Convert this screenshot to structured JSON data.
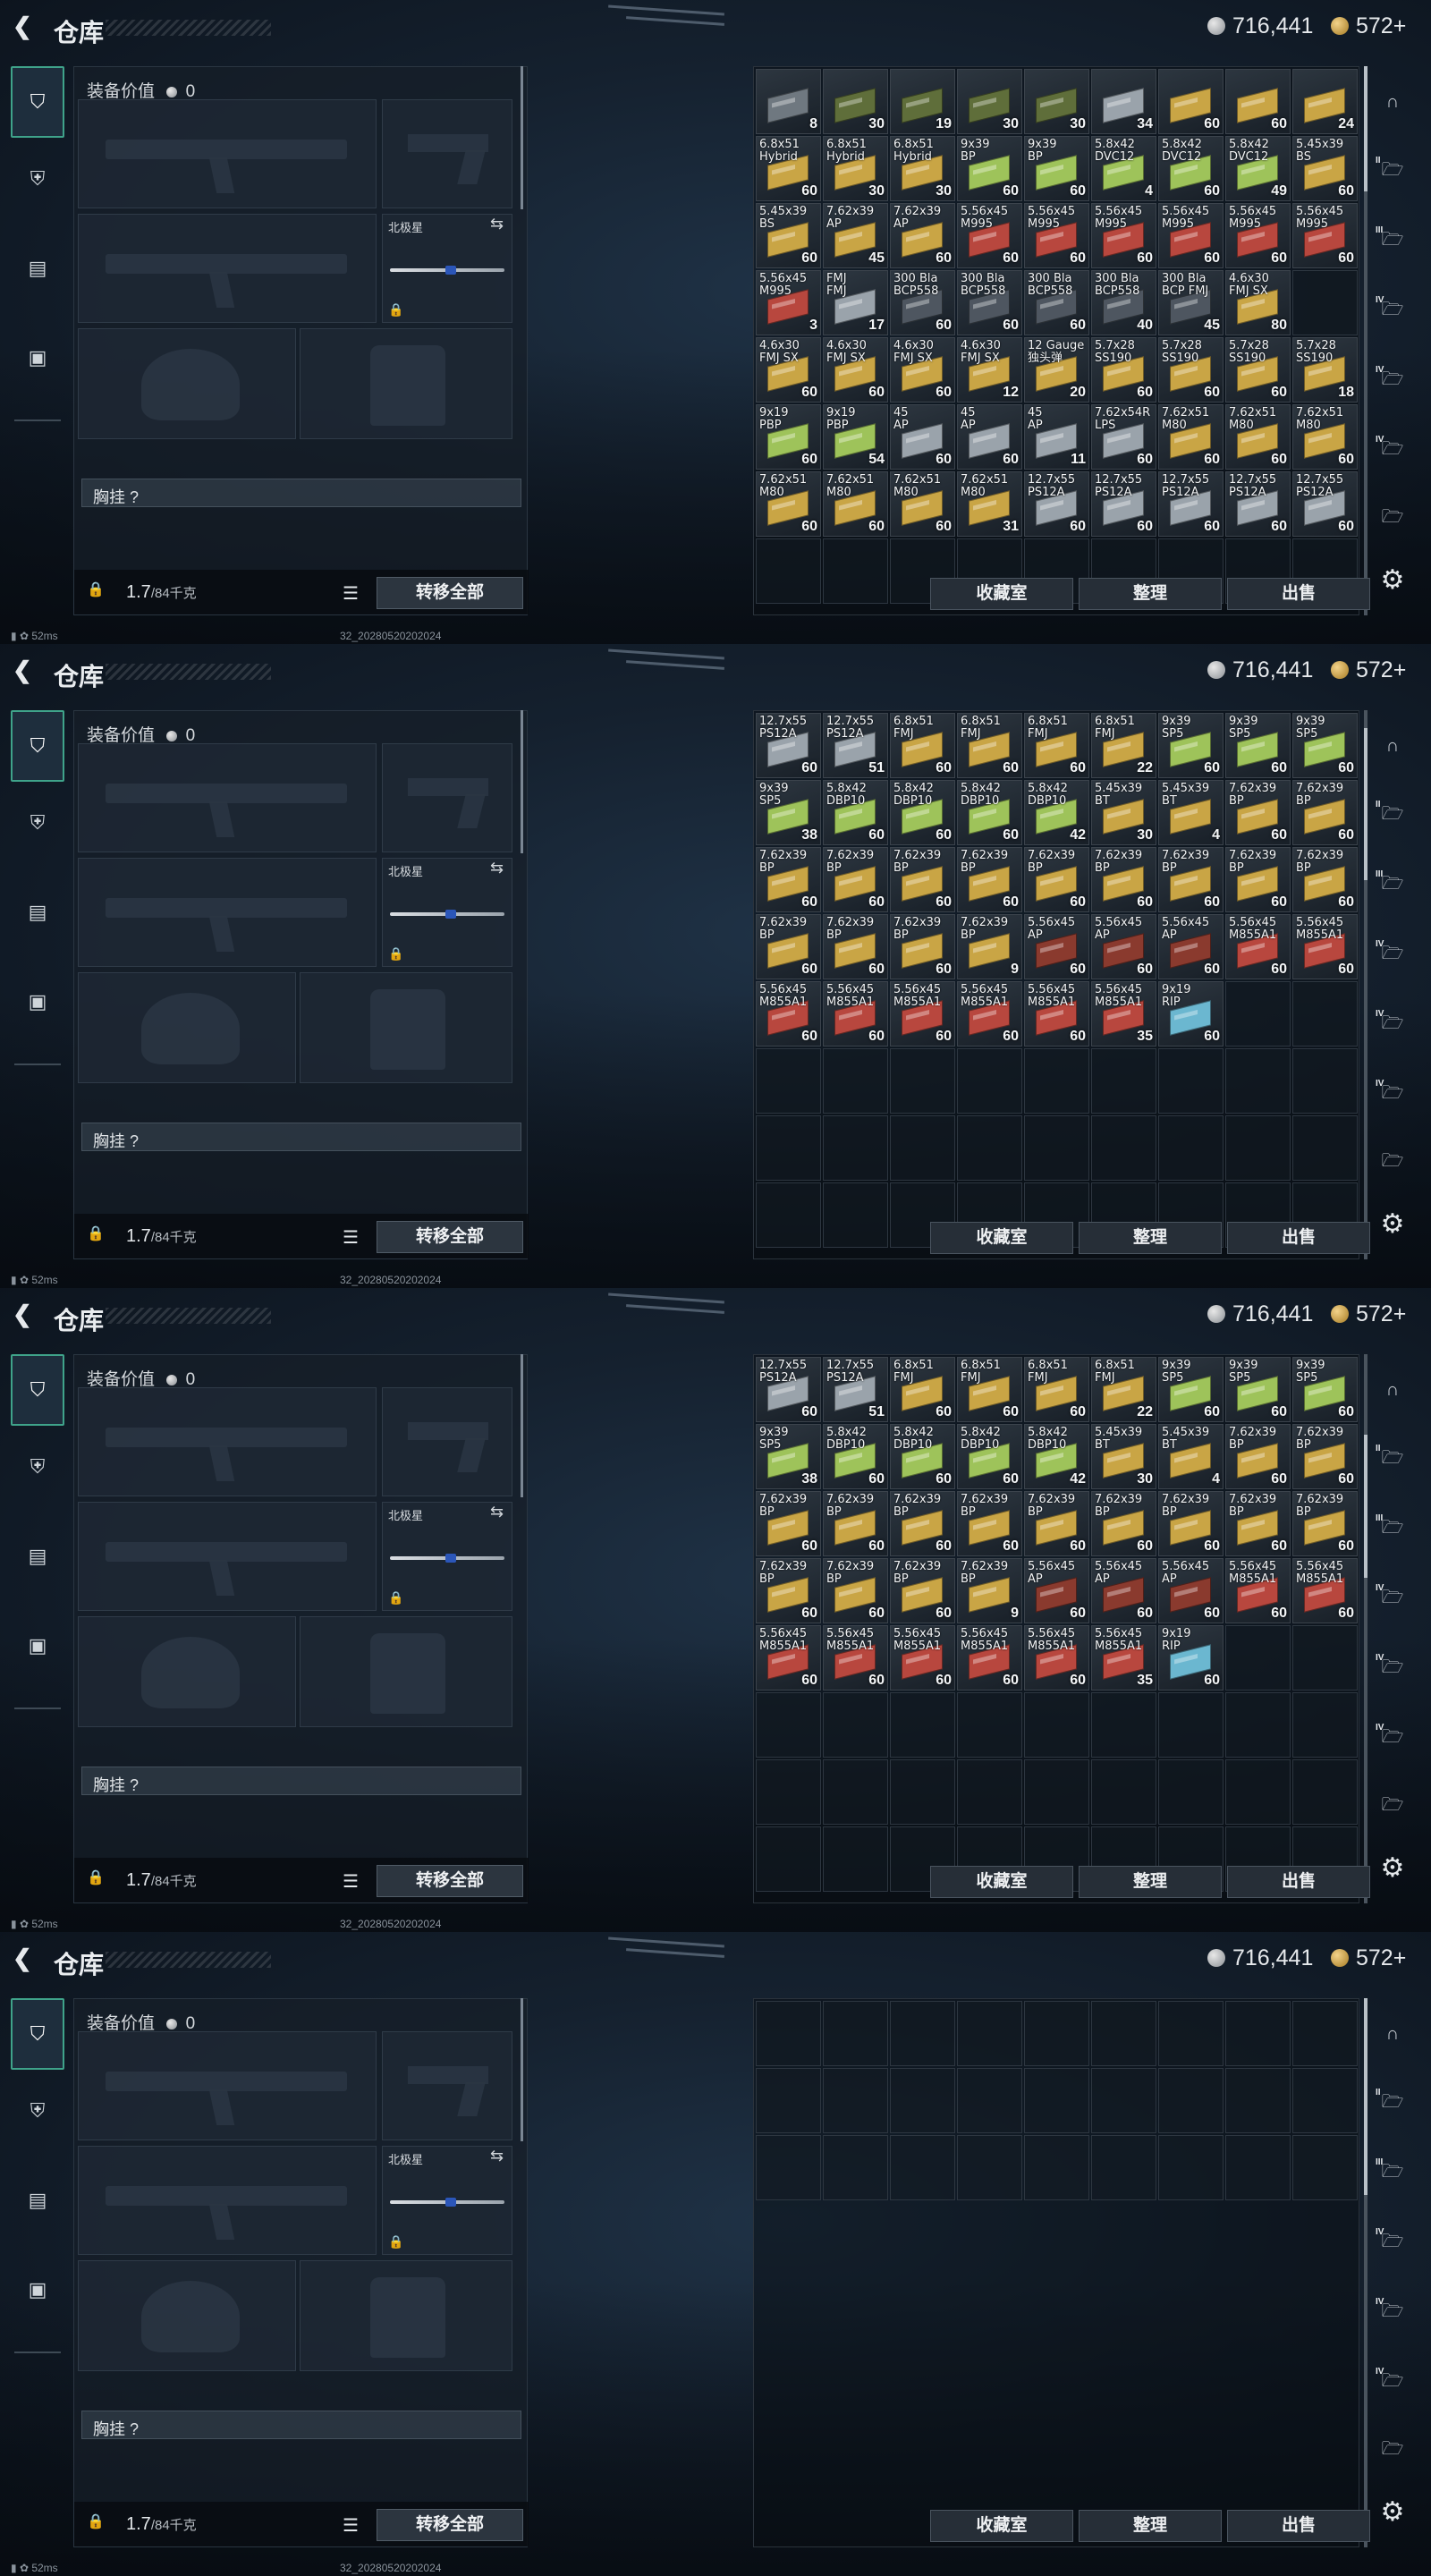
{
  "app": {
    "title": "仓库",
    "back_icon": "back-arrow-icon"
  },
  "currency": {
    "silver": "716,441",
    "gold": "572+"
  },
  "loadout": {
    "header_label": "装备价值",
    "header_value": "0",
    "knife_label": "北极星",
    "chest_rig_label": "胸挂 ?",
    "weight_value": "1.7",
    "weight_capacity": "/84千克",
    "transfer_button": "转移全部"
  },
  "stash_buttons": {
    "collection": "收藏室",
    "sort": "整理",
    "sell": "出售"
  },
  "status": {
    "ping": "52ms",
    "build": "32_20280520202024"
  },
  "colors": {
    "accent": "#3fa38a",
    "gold": "#c9a545",
    "silver": "#b7bcc2"
  },
  "frames": [
    {
      "items": [
        {
          "n": "",
          "q": "8",
          "c": "#6f7880"
        },
        {
          "n": "",
          "q": "30",
          "c": "#5f6e3a"
        },
        {
          "n": "",
          "q": "19",
          "c": "#5f6e3a"
        },
        {
          "n": "",
          "q": "30",
          "c": "#5f6e3a"
        },
        {
          "n": "",
          "q": "30",
          "c": "#5f6e3a"
        },
        {
          "n": "",
          "q": "34",
          "c": "#9aa3ab"
        },
        {
          "n": "",
          "q": "60",
          "c": "#c9a545"
        },
        {
          "n": "",
          "q": "60",
          "c": "#c9a545"
        },
        {
          "n": "",
          "q": "24",
          "c": "#c9a545"
        },
        {
          "n": "6.8x51\nHybrid",
          "q": "60",
          "c": "#c9a545"
        },
        {
          "n": "6.8x51\nHybrid",
          "q": "30",
          "c": "#c9a545"
        },
        {
          "n": "6.8x51\nHybrid",
          "q": "30",
          "c": "#c9a545"
        },
        {
          "n": "9x39\nBP",
          "q": "60",
          "c": "#9ec35a"
        },
        {
          "n": "9x39\nBP",
          "q": "60",
          "c": "#9ec35a"
        },
        {
          "n": "5.8x42\nDVC12",
          "q": "4",
          "c": "#9ec35a"
        },
        {
          "n": "5.8x42\nDVC12",
          "q": "60",
          "c": "#9ec35a"
        },
        {
          "n": "5.8x42\nDVC12",
          "q": "49",
          "c": "#9ec35a"
        },
        {
          "n": "5.45x39\nBS",
          "q": "60",
          "c": "#c9a545"
        },
        {
          "n": "5.45x39\nBS",
          "q": "60",
          "c": "#c9a545"
        },
        {
          "n": "7.62x39\nAP",
          "q": "45",
          "c": "#c9a545"
        },
        {
          "n": "7.62x39\nAP",
          "q": "60",
          "c": "#c9a545"
        },
        {
          "n": "5.56x45\nM995",
          "q": "60",
          "c": "#b8473e"
        },
        {
          "n": "5.56x45\nM995",
          "q": "60",
          "c": "#b8473e"
        },
        {
          "n": "5.56x45\nM995",
          "q": "60",
          "c": "#b8473e"
        },
        {
          "n": "5.56x45\nM995",
          "q": "60",
          "c": "#b8473e"
        },
        {
          "n": "5.56x45\nM995",
          "q": "60",
          "c": "#b8473e"
        },
        {
          "n": "5.56x45\nM995",
          "q": "60",
          "c": "#b8473e"
        },
        {
          "n": "5.56x45\nM995",
          "q": "3",
          "c": "#b8473e"
        },
        {
          "n": "FMJ\nFMJ",
          "q": "17",
          "c": "#9aa3ab"
        },
        {
          "n": "300 Bla\nBCP558",
          "q": "60",
          "c": "#4e5660"
        },
        {
          "n": "300 Bla\nBCP558",
          "q": "60",
          "c": "#4e5660"
        },
        {
          "n": "300 Bla\nBCP558",
          "q": "60",
          "c": "#4e5660"
        },
        {
          "n": "300 Bla\nBCP558",
          "q": "40",
          "c": "#4e5660"
        },
        {
          "n": "300 Bla\nBCP FMJ",
          "q": "45",
          "c": "#4e5660"
        },
        {
          "n": "4.6x30\nFMJ SX",
          "q": "80",
          "c": "#c9a545"
        },
        {
          "n": "",
          "q": "",
          "c": ""
        },
        {
          "n": "4.6x30\nFMJ SX",
          "q": "60",
          "c": "#c9a545"
        },
        {
          "n": "4.6x30\nFMJ SX",
          "q": "60",
          "c": "#c9a545"
        },
        {
          "n": "4.6x30\nFMJ SX",
          "q": "60",
          "c": "#c9a545"
        },
        {
          "n": "4.6x30\nFMJ SX",
          "q": "12",
          "c": "#c9a545"
        },
        {
          "n": "12 Gauge\n独头弹",
          "q": "20",
          "c": "#c9a545"
        },
        {
          "n": "5.7x28\nSS190",
          "q": "60",
          "c": "#c9a545"
        },
        {
          "n": "5.7x28\nSS190",
          "q": "60",
          "c": "#c9a545"
        },
        {
          "n": "5.7x28\nSS190",
          "q": "60",
          "c": "#c9a545"
        },
        {
          "n": "5.7x28\nSS190",
          "q": "18",
          "c": "#c9a545"
        },
        {
          "n": "9x19\nPBP",
          "q": "60",
          "c": "#9ec35a"
        },
        {
          "n": "9x19\nPBP",
          "q": "54",
          "c": "#9ec35a"
        },
        {
          "n": "45\nAP",
          "q": "60",
          "c": "#9aa3ab"
        },
        {
          "n": "45\nAP",
          "q": "60",
          "c": "#9aa3ab"
        },
        {
          "n": "45\nAP",
          "q": "11",
          "c": "#9aa3ab"
        },
        {
          "n": "7.62x54R\nLPS",
          "q": "60",
          "c": "#9aa3ab"
        },
        {
          "n": "7.62x51\nM80",
          "q": "60",
          "c": "#c9a545"
        },
        {
          "n": "7.62x51\nM80",
          "q": "60",
          "c": "#c9a545"
        },
        {
          "n": "7.62x51\nM80",
          "q": "60",
          "c": "#c9a545"
        },
        {
          "n": "7.62x51\nM80",
          "q": "60",
          "c": "#c9a545"
        },
        {
          "n": "7.62x51\nM80",
          "q": "60",
          "c": "#c9a545"
        },
        {
          "n": "7.62x51\nM80",
          "q": "60",
          "c": "#c9a545"
        },
        {
          "n": "7.62x51\nM80",
          "q": "31",
          "c": "#c9a545"
        },
        {
          "n": "12.7x55\nPS12A",
          "q": "60",
          "c": "#9aa3ab"
        },
        {
          "n": "12.7x55\nPS12A",
          "q": "60",
          "c": "#9aa3ab"
        },
        {
          "n": "12.7x55\nPS12A",
          "q": "60",
          "c": "#9aa3ab"
        },
        {
          "n": "12.7x55\nPS12A",
          "q": "60",
          "c": "#9aa3ab"
        },
        {
          "n": "12.7x55\nPS12A",
          "q": "60",
          "c": "#9aa3ab"
        }
      ]
    },
    {
      "items": [
        {
          "n": "12.7x55\nPS12A",
          "q": "60",
          "c": "#9aa3ab"
        },
        {
          "n": "12.7x55\nPS12A",
          "q": "51",
          "c": "#9aa3ab"
        },
        {
          "n": "6.8x51\nFMJ",
          "q": "60",
          "c": "#c9a545"
        },
        {
          "n": "6.8x51\nFMJ",
          "q": "60",
          "c": "#c9a545"
        },
        {
          "n": "6.8x51\nFMJ",
          "q": "60",
          "c": "#c9a545"
        },
        {
          "n": "6.8x51\nFMJ",
          "q": "22",
          "c": "#c9a545"
        },
        {
          "n": "9x39\nSP5",
          "q": "60",
          "c": "#9ec35a"
        },
        {
          "n": "9x39\nSP5",
          "q": "60",
          "c": "#9ec35a"
        },
        {
          "n": "9x39\nSP5",
          "q": "60",
          "c": "#9ec35a"
        },
        {
          "n": "9x39\nSP5",
          "q": "38",
          "c": "#9ec35a"
        },
        {
          "n": "5.8x42\nDBP10",
          "q": "60",
          "c": "#9ec35a"
        },
        {
          "n": "5.8x42\nDBP10",
          "q": "60",
          "c": "#9ec35a"
        },
        {
          "n": "5.8x42\nDBP10",
          "q": "60",
          "c": "#9ec35a"
        },
        {
          "n": "5.8x42\nDBP10",
          "q": "42",
          "c": "#9ec35a"
        },
        {
          "n": "5.45x39\nBT",
          "q": "30",
          "c": "#c9a545"
        },
        {
          "n": "5.45x39\nBT",
          "q": "4",
          "c": "#c9a545"
        },
        {
          "n": "7.62x39\nBP",
          "q": "60",
          "c": "#c9a545"
        },
        {
          "n": "7.62x39\nBP",
          "q": "60",
          "c": "#c9a545"
        },
        {
          "n": "7.62x39\nBP",
          "q": "60",
          "c": "#c9a545"
        },
        {
          "n": "7.62x39\nBP",
          "q": "60",
          "c": "#c9a545"
        },
        {
          "n": "7.62x39\nBP",
          "q": "60",
          "c": "#c9a545"
        },
        {
          "n": "7.62x39\nBP",
          "q": "60",
          "c": "#c9a545"
        },
        {
          "n": "7.62x39\nBP",
          "q": "60",
          "c": "#c9a545"
        },
        {
          "n": "7.62x39\nBP",
          "q": "60",
          "c": "#c9a545"
        },
        {
          "n": "7.62x39\nBP",
          "q": "60",
          "c": "#c9a545"
        },
        {
          "n": "7.62x39\nBP",
          "q": "60",
          "c": "#c9a545"
        },
        {
          "n": "7.62x39\nBP",
          "q": "60",
          "c": "#c9a545"
        },
        {
          "n": "7.62x39\nBP",
          "q": "60",
          "c": "#c9a545"
        },
        {
          "n": "7.62x39\nBP",
          "q": "60",
          "c": "#c9a545"
        },
        {
          "n": "7.62x39\nBP",
          "q": "60",
          "c": "#c9a545"
        },
        {
          "n": "7.62x39\nBP",
          "q": "9",
          "c": "#c9a545"
        },
        {
          "n": "5.56x45\nAP",
          "q": "60",
          "c": "#8a3a2e"
        },
        {
          "n": "5.56x45\nAP",
          "q": "60",
          "c": "#8a3a2e"
        },
        {
          "n": "5.56x45\nAP",
          "q": "60",
          "c": "#8a3a2e"
        },
        {
          "n": "5.56x45\nM855A1",
          "q": "60",
          "c": "#b8473e"
        },
        {
          "n": "5.56x45\nM855A1",
          "q": "60",
          "c": "#b8473e"
        },
        {
          "n": "5.56x45\nM855A1",
          "q": "60",
          "c": "#b8473e"
        },
        {
          "n": "5.56x45\nM855A1",
          "q": "60",
          "c": "#b8473e"
        },
        {
          "n": "5.56x45\nM855A1",
          "q": "60",
          "c": "#b8473e"
        },
        {
          "n": "5.56x45\nM855A1",
          "q": "60",
          "c": "#b8473e"
        },
        {
          "n": "5.56x45\nM855A1",
          "q": "60",
          "c": "#b8473e"
        },
        {
          "n": "5.56x45\nM855A1",
          "q": "35",
          "c": "#b8473e"
        },
        {
          "n": "9x19\nRIP",
          "q": "60",
          "c": "#6bb7d0"
        }
      ]
    },
    {
      "items": [
        {
          "n": "12.7x55\nPS12A",
          "q": "60",
          "c": "#9aa3ab"
        },
        {
          "n": "12.7x55\nPS12A",
          "q": "51",
          "c": "#9aa3ab"
        },
        {
          "n": "6.8x51\nFMJ",
          "q": "60",
          "c": "#c9a545"
        },
        {
          "n": "6.8x51\nFMJ",
          "q": "60",
          "c": "#c9a545"
        },
        {
          "n": "6.8x51\nFMJ",
          "q": "60",
          "c": "#c9a545"
        },
        {
          "n": "6.8x51\nFMJ",
          "q": "22",
          "c": "#c9a545"
        },
        {
          "n": "9x39\nSP5",
          "q": "60",
          "c": "#9ec35a"
        },
        {
          "n": "9x39\nSP5",
          "q": "60",
          "c": "#9ec35a"
        },
        {
          "n": "9x39\nSP5",
          "q": "60",
          "c": "#9ec35a"
        },
        {
          "n": "9x39\nSP5",
          "q": "38",
          "c": "#9ec35a"
        },
        {
          "n": "5.8x42\nDBP10",
          "q": "60",
          "c": "#9ec35a"
        },
        {
          "n": "5.8x42\nDBP10",
          "q": "60",
          "c": "#9ec35a"
        },
        {
          "n": "5.8x42\nDBP10",
          "q": "60",
          "c": "#9ec35a"
        },
        {
          "n": "5.8x42\nDBP10",
          "q": "42",
          "c": "#9ec35a"
        },
        {
          "n": "5.45x39\nBT",
          "q": "30",
          "c": "#c9a545"
        },
        {
          "n": "5.45x39\nBT",
          "q": "4",
          "c": "#c9a545"
        },
        {
          "n": "7.62x39\nBP",
          "q": "60",
          "c": "#c9a545"
        },
        {
          "n": "7.62x39\nBP",
          "q": "60",
          "c": "#c9a545"
        },
        {
          "n": "7.62x39\nBP",
          "q": "60",
          "c": "#c9a545"
        },
        {
          "n": "7.62x39\nBP",
          "q": "60",
          "c": "#c9a545"
        },
        {
          "n": "7.62x39\nBP",
          "q": "60",
          "c": "#c9a545"
        },
        {
          "n": "7.62x39\nBP",
          "q": "60",
          "c": "#c9a545"
        },
        {
          "n": "7.62x39\nBP",
          "q": "60",
          "c": "#c9a545"
        },
        {
          "n": "7.62x39\nBP",
          "q": "60",
          "c": "#c9a545"
        },
        {
          "n": "7.62x39\nBP",
          "q": "60",
          "c": "#c9a545"
        },
        {
          "n": "7.62x39\nBP",
          "q": "60",
          "c": "#c9a545"
        },
        {
          "n": "7.62x39\nBP",
          "q": "60",
          "c": "#c9a545"
        },
        {
          "n": "7.62x39\nBP",
          "q": "60",
          "c": "#c9a545"
        },
        {
          "n": "7.62x39\nBP",
          "q": "60",
          "c": "#c9a545"
        },
        {
          "n": "7.62x39\nBP",
          "q": "60",
          "c": "#c9a545"
        },
        {
          "n": "7.62x39\nBP",
          "q": "9",
          "c": "#c9a545"
        },
        {
          "n": "5.56x45\nAP",
          "q": "60",
          "c": "#8a3a2e"
        },
        {
          "n": "5.56x45\nAP",
          "q": "60",
          "c": "#8a3a2e"
        },
        {
          "n": "5.56x45\nAP",
          "q": "60",
          "c": "#8a3a2e"
        },
        {
          "n": "5.56x45\nM855A1",
          "q": "60",
          "c": "#b8473e"
        },
        {
          "n": "5.56x45\nM855A1",
          "q": "60",
          "c": "#b8473e"
        },
        {
          "n": "5.56x45\nM855A1",
          "q": "60",
          "c": "#b8473e"
        },
        {
          "n": "5.56x45\nM855A1",
          "q": "60",
          "c": "#b8473e"
        },
        {
          "n": "5.56x45\nM855A1",
          "q": "60",
          "c": "#b8473e"
        },
        {
          "n": "5.56x45\nM855A1",
          "q": "60",
          "c": "#b8473e"
        },
        {
          "n": "5.56x45\nM855A1",
          "q": "60",
          "c": "#b8473e"
        },
        {
          "n": "5.56x45\nM855A1",
          "q": "35",
          "c": "#b8473e"
        },
        {
          "n": "9x19\nRIP",
          "q": "60",
          "c": "#6bb7d0"
        }
      ]
    },
    {
      "items": []
    }
  ]
}
